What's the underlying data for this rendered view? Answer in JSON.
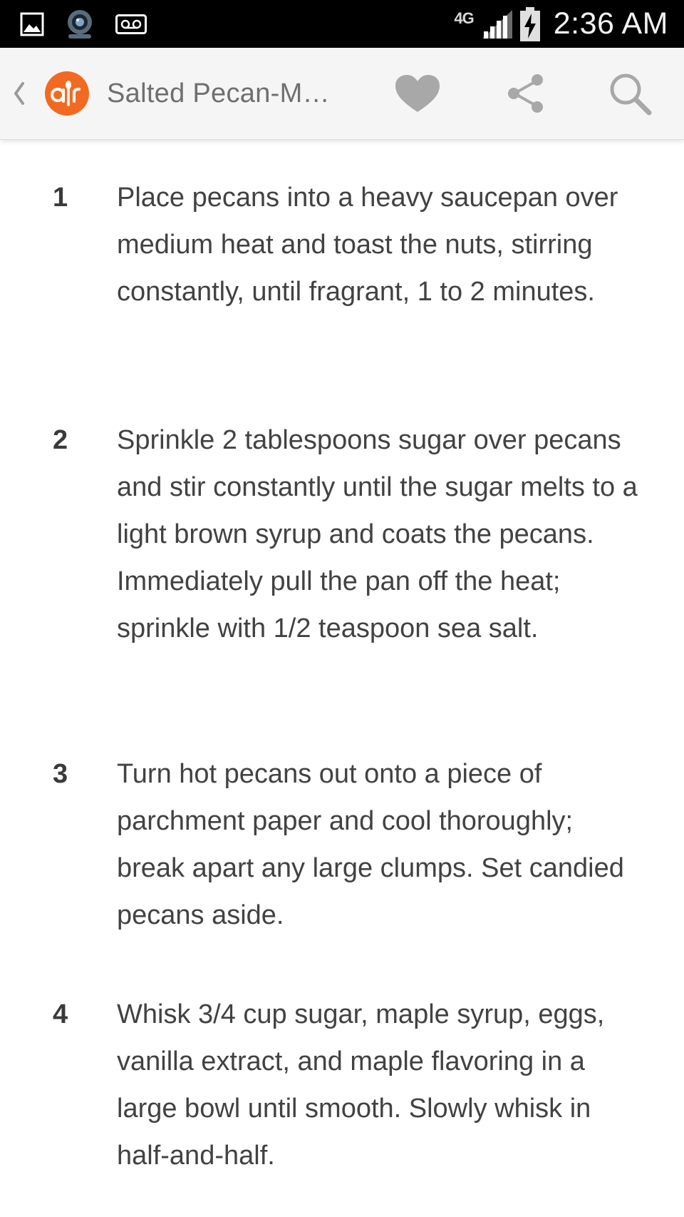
{
  "status_bar": {
    "time": "2:36 AM",
    "network": "4G",
    "left_icons": [
      "gallery-icon",
      "camera-icon",
      "voicemail-icon"
    ],
    "right_icons": [
      "signal-icon",
      "battery-charging-icon"
    ]
  },
  "app_bar": {
    "back_icon": "chevron-left-icon",
    "logo_icon": "allrecipes-logo",
    "title": "Salted Pecan-Ma…",
    "actions": [
      "heart-icon",
      "share-icon",
      "search-icon"
    ],
    "accent_color": "#f26a21",
    "icon_color": "#a8a8a8"
  },
  "steps": [
    {
      "number": "1",
      "text": "Place pecans into a heavy saucepan over medium heat and toast the nuts, stirring constantly, until fragrant, 1 to 2 minutes."
    },
    {
      "number": "2",
      "text": "Sprinkle 2 tablespoons sugar over pecans and stir constantly until the sugar melts to a light brown syrup and coats the pecans. Immediately pull the pan off the heat; sprinkle with 1/2 teaspoon sea salt."
    },
    {
      "number": "3",
      "text": "Turn hot pecans out onto a piece of parchment paper and cool thoroughly; break apart any large clumps. Set candied pecans aside."
    },
    {
      "number": "4",
      "text": "Whisk 3/4 cup sugar, maple syrup, eggs, vanilla extract, and maple flavoring in a large bowl until smooth. Slowly whisk in half-and-half."
    }
  ]
}
